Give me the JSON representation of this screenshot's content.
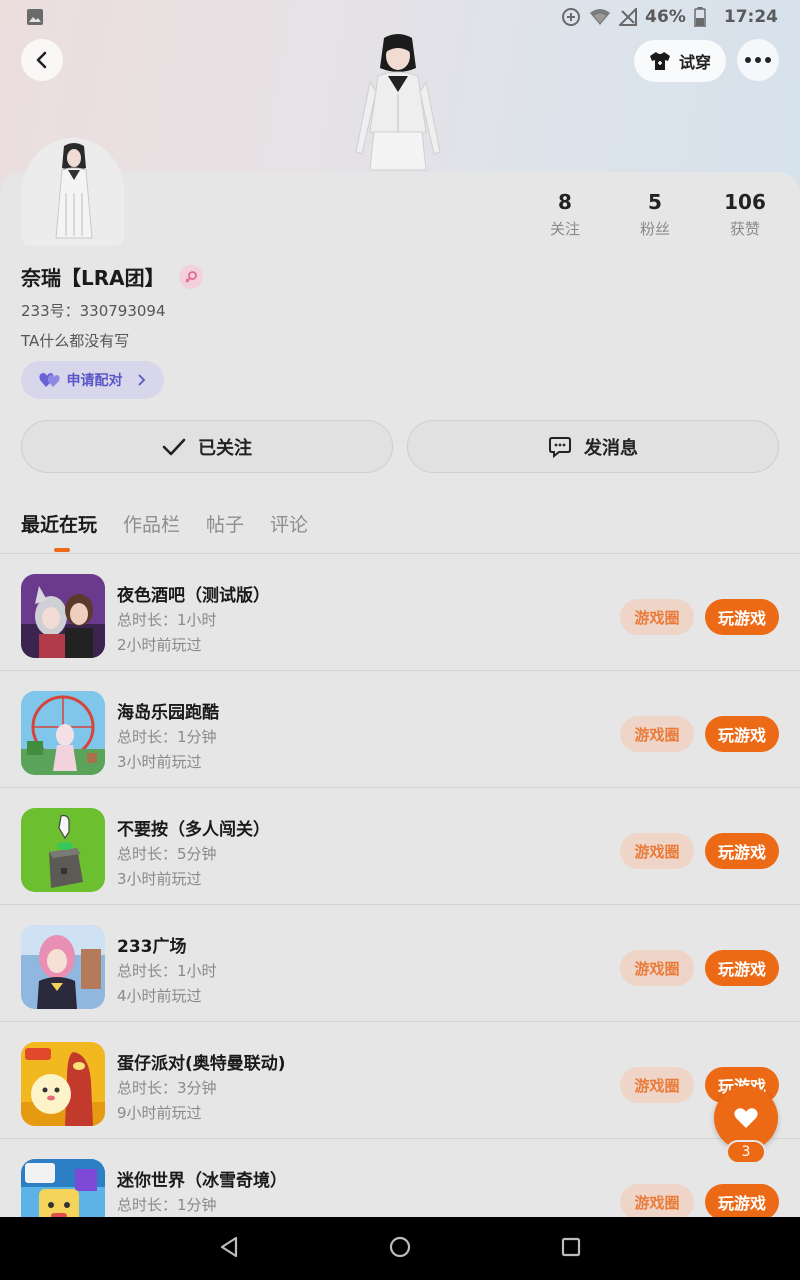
{
  "status_bar": {
    "battery": "46%",
    "time": "17:24"
  },
  "header": {
    "try_on_label": "试穿"
  },
  "profile": {
    "name": "奈瑞【LRA团】",
    "uid": "233号：330793094",
    "bio": "TA什么都没有写",
    "pair_label": "申请配对",
    "stats": [
      {
        "num": "8",
        "label": "关注"
      },
      {
        "num": "5",
        "label": "粉丝"
      },
      {
        "num": "106",
        "label": "获赞"
      }
    ],
    "followed_label": "已关注",
    "message_label": "发消息"
  },
  "tabs": [
    {
      "label": "最近在玩",
      "active": true
    },
    {
      "label": "作品栏",
      "active": false
    },
    {
      "label": "帖子",
      "active": false
    },
    {
      "label": "评论",
      "active": false
    }
  ],
  "games": [
    {
      "title": "夜色酒吧（测试版）",
      "duration": "总时长：1小时",
      "last_played": "2小时前玩过",
      "icon": "game-icon-night-bar"
    },
    {
      "title": "海岛乐园跑酷",
      "duration": "总时长：1分钟",
      "last_played": "3小时前玩过",
      "icon": "game-icon-island-parkour"
    },
    {
      "title": "不要按（多人闯关）",
      "duration": "总时长：5分钟",
      "last_played": "3小时前玩过",
      "icon": "game-icon-dont-press"
    },
    {
      "title": "233广场",
      "duration": "总时长：1小时",
      "last_played": "4小时前玩过",
      "icon": "game-icon-233-plaza"
    },
    {
      "title": "蛋仔派对(奥特曼联动)",
      "duration": "总时长：3分钟",
      "last_played": "9小时前玩过",
      "icon": "game-icon-eggy-party"
    },
    {
      "title": "迷你世界（冰雪奇境）",
      "duration": "总时长：1分钟",
      "last_played": "",
      "icon": "game-icon-mini-world"
    }
  ],
  "game_actions": {
    "circle_label": "游戏圈",
    "play_label": "玩游戏"
  },
  "like_count": "3",
  "colors": {
    "accent": "#ec6915",
    "circle_tag_bg": "#eed5c7",
    "pair_bg": "#d7d6ea"
  }
}
